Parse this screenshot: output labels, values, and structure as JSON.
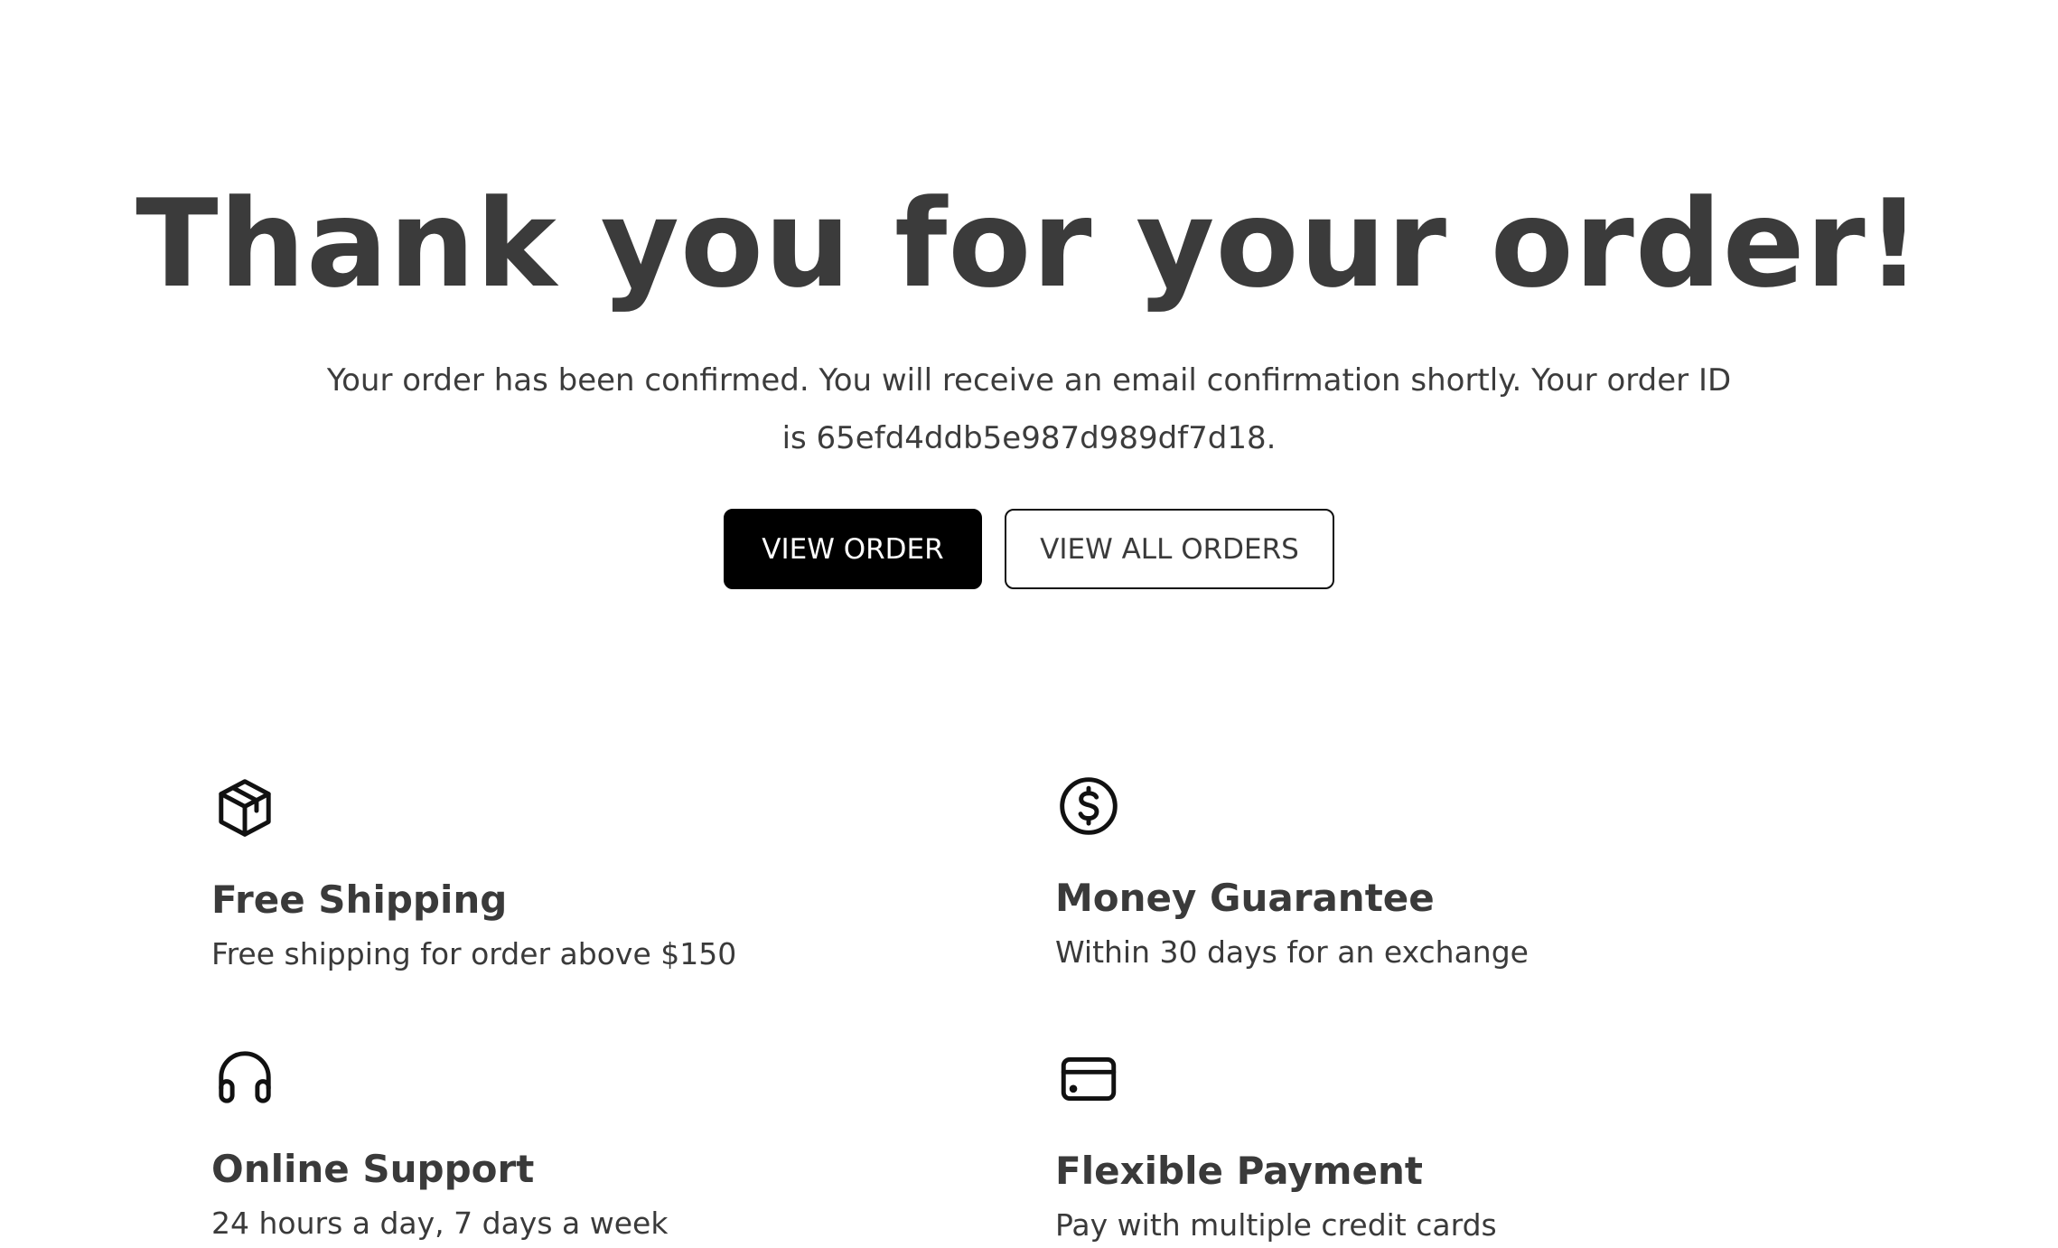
{
  "hero": {
    "title": "Thank you for your order!",
    "message": "Your order has been confirmed. You will receive an email confirmation shortly. Your order ID is 65efd4ddb5e987d989df7d18."
  },
  "buttons": {
    "view_order": "VIEW ORDER",
    "view_all_orders": "VIEW ALL ORDERS"
  },
  "features": [
    {
      "icon": "package-icon",
      "title": "Free Shipping",
      "description": "Free shipping for order above $150"
    },
    {
      "icon": "dollar-circle-icon",
      "title": "Money Guarantee",
      "description": "Within 30 days for an exchange"
    },
    {
      "icon": "headphones-icon",
      "title": "Online Support",
      "description": "24 hours a day, 7 days a week"
    },
    {
      "icon": "credit-card-icon",
      "title": "Flexible Payment",
      "description": "Pay with multiple credit cards"
    }
  ],
  "colors": {
    "text": "#3a3a3a",
    "primary_button_bg": "#000000",
    "primary_button_text": "#ffffff",
    "background": "#ffffff"
  }
}
